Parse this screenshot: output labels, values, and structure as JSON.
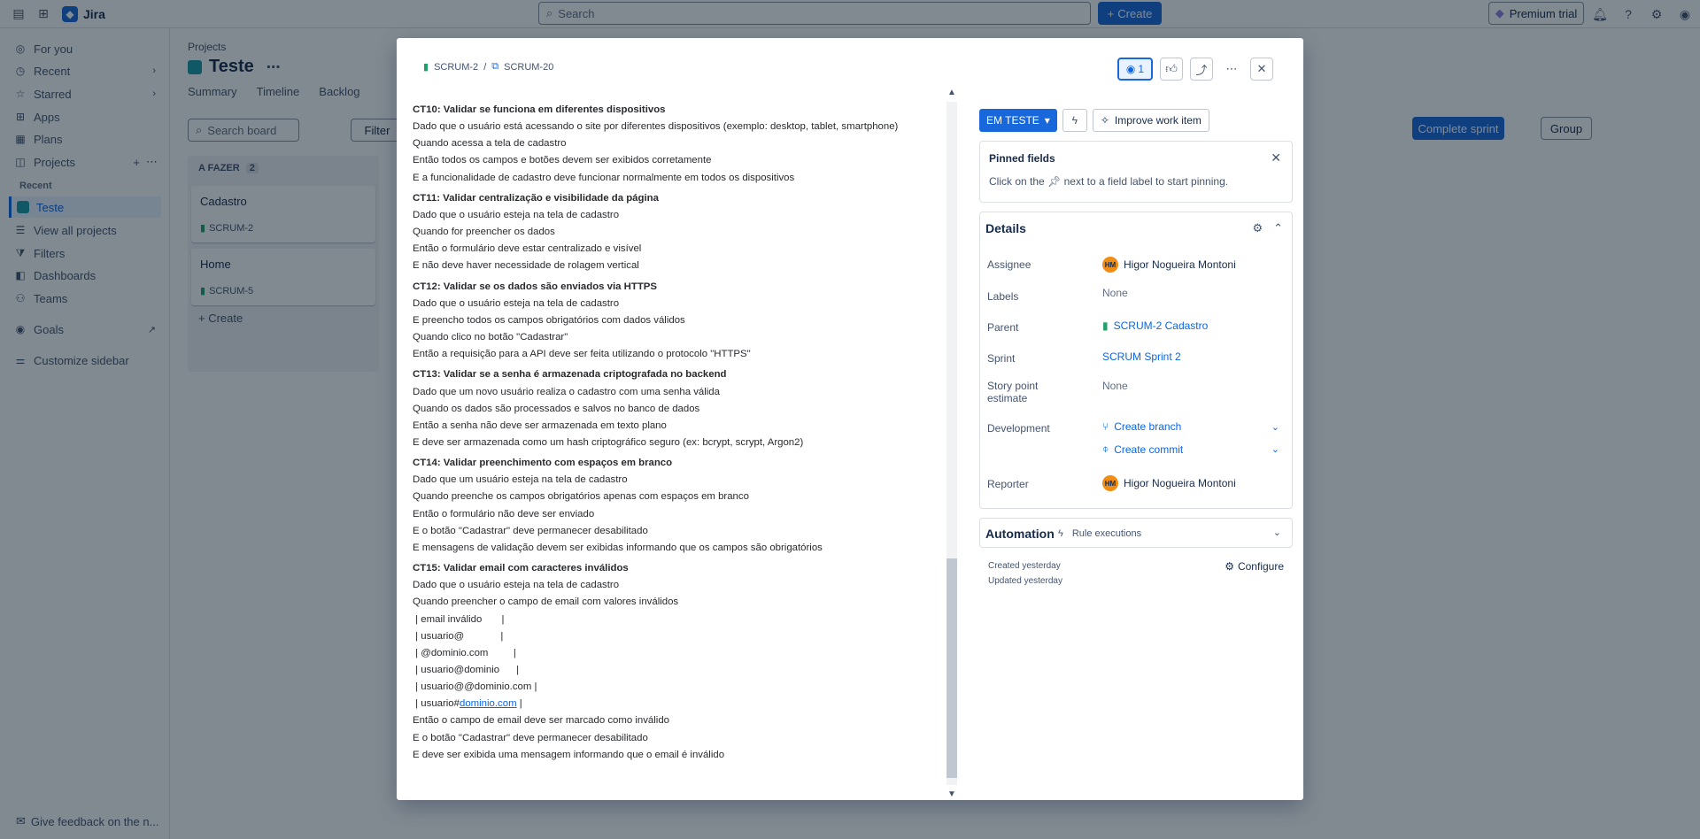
{
  "app": {
    "name": "Jira"
  },
  "topbar": {
    "search_placeholder": "Search",
    "create_label": "Create",
    "premium_label": "Premium trial"
  },
  "sidebar": {
    "items": [
      {
        "label": "For you",
        "icon": "user-circle-icon"
      },
      {
        "label": "Recent",
        "icon": "clock-icon"
      },
      {
        "label": "Starred",
        "icon": "star-icon"
      },
      {
        "label": "Apps",
        "icon": "apps-icon"
      },
      {
        "label": "Plans",
        "icon": "plans-icon"
      },
      {
        "label": "Projects",
        "icon": "projects-icon"
      }
    ],
    "recent_heading": "Recent",
    "project_item": "Teste",
    "view_all": "View all projects",
    "lower_items": [
      {
        "label": "Filters"
      },
      {
        "label": "Dashboards"
      },
      {
        "label": "Teams"
      },
      {
        "label": "Goals"
      },
      {
        "label": "Customize sidebar"
      }
    ],
    "feedback": "Give feedback on the n..."
  },
  "main": {
    "breadcrumb": "Projects",
    "title": "Teste",
    "tabs": [
      "Summary",
      "Timeline",
      "Backlog"
    ],
    "board_search_placeholder": "Search board",
    "filter_label": "Filter",
    "column": {
      "title": "A FAZER",
      "count": "2"
    },
    "cards": [
      {
        "title": "Cadastro",
        "key": "SCRUM-2"
      },
      {
        "title": "Home",
        "key": "SCRUM-5"
      }
    ],
    "col_create": "Create",
    "complete_sprint": "Complete sprint",
    "group": "Group"
  },
  "modal": {
    "breadcrumb": {
      "parent": "SCRUM-2",
      "current": "SCRUM-20"
    },
    "watch_count": "1",
    "description": [
      {
        "type": "h",
        "text": "CT10: Validar se funciona em diferentes dispositivos"
      },
      {
        "type": "p",
        "text": "Dado que o usuário está acessando o site por diferentes dispositivos (exemplo: desktop, tablet, smartphone)"
      },
      {
        "type": "p",
        "text": "Quando acessa a tela de cadastro"
      },
      {
        "type": "p",
        "text": "Então todos os campos e botões devem ser exibidos corretamente"
      },
      {
        "type": "p",
        "text": "E a funcionalidade de cadastro deve funcionar normalmente em todos os dispositivos"
      },
      {
        "type": "h",
        "text": "CT11: Validar centralização e visibilidade da página"
      },
      {
        "type": "p",
        "text": "Dado que o usuário esteja na tela de cadastro"
      },
      {
        "type": "p",
        "text": "Quando for preencher os dados"
      },
      {
        "type": "p",
        "text": "Então o formulário deve estar centralizado e visível"
      },
      {
        "type": "p",
        "text": "E não deve haver necessidade de rolagem vertical"
      },
      {
        "type": "h",
        "text": "CT12: Validar se os dados são enviados via HTTPS"
      },
      {
        "type": "p",
        "text": "Dado que o usuário esteja na tela de cadastro"
      },
      {
        "type": "p",
        "text": "E preencho todos os campos obrigatórios com dados válidos"
      },
      {
        "type": "p",
        "text": "Quando clico no botão \"Cadastrar\""
      },
      {
        "type": "p",
        "text": "Então a requisição para a API deve ser feita utilizando o protocolo \"HTTPS\""
      },
      {
        "type": "h",
        "text": "CT13: Validar se a senha é armazenada criptografada no backend"
      },
      {
        "type": "p",
        "text": "Dado que um novo usuário realiza o cadastro com uma senha válida"
      },
      {
        "type": "p",
        "text": "Quando os dados são processados e salvos no banco de dados"
      },
      {
        "type": "p",
        "text": "Então a senha não deve ser armazenada em texto plano"
      },
      {
        "type": "p",
        "text": "E deve ser armazenada como um hash criptográfico seguro (ex: bcrypt, scrypt, Argon2)"
      },
      {
        "type": "h",
        "text": "CT14: Validar preenchimento com espaços em branco"
      },
      {
        "type": "p",
        "text": "Dado que um usuário esteja na tela de cadastro"
      },
      {
        "type": "p",
        "text": "Quando preenche os campos obrigatórios apenas com espaços em branco"
      },
      {
        "type": "p",
        "text": "Então o formulário não deve ser enviado"
      },
      {
        "type": "p",
        "text": "E o botão \"Cadastrar\" deve permanecer desabilitado"
      },
      {
        "type": "p",
        "text": "E mensagens de validação devem ser exibidas informando que os campos são obrigatórios"
      },
      {
        "type": "h",
        "text": "CT15: Validar email com caracteres inválidos"
      },
      {
        "type": "p",
        "text": "Dado que o usuário esteja na tela de cadastro"
      },
      {
        "type": "p",
        "text": "Quando preencher o campo de email com valores inválidos"
      },
      {
        "type": "p",
        "text": " | email inválido       |"
      },
      {
        "type": "p",
        "text": " | usuario@             |"
      },
      {
        "type": "p",
        "text": " | @dominio.com         |"
      },
      {
        "type": "p",
        "text": " | usuario@dominio      |"
      },
      {
        "type": "p",
        "text": " | usuario@@dominio.com |"
      },
      {
        "type": "link",
        "prefix": " | usuario#",
        "link": "dominio.com",
        "suffix": " |"
      },
      {
        "type": "p",
        "text": "Então o campo de email deve ser marcado como inválido"
      },
      {
        "type": "p",
        "text": "E o botão \"Cadastrar\" deve permanecer desabilitado"
      },
      {
        "type": "p",
        "text": "E deve ser exibida uma mensagem informando que o email é inválido"
      }
    ],
    "status": "EM TESTE",
    "improve_label": "Improve work item",
    "pinned": {
      "title": "Pinned fields",
      "text_before": "Click on the",
      "text_after": "next to a field label to start pinning."
    },
    "details": {
      "title": "Details",
      "assignee_label": "Assignee",
      "assignee_initials": "HM",
      "assignee_name": "Higor Nogueira Montoni",
      "labels_label": "Labels",
      "labels_value": "None",
      "parent_label": "Parent",
      "parent_value": "SCRUM-2 Cadastro",
      "sprint_label": "Sprint",
      "sprint_value": "SCRUM Sprint 2",
      "story_label": "Story point estimate",
      "story_value": "None",
      "development_label": "Development",
      "create_branch": "Create branch",
      "create_commit": "Create commit",
      "reporter_label": "Reporter",
      "reporter_initials": "HM",
      "reporter_name": "Higor Nogueira Montoni"
    },
    "automation": {
      "title": "Automation",
      "sub": "Rule executions"
    },
    "created": "Created yesterday",
    "updated": "Updated yesterday",
    "configure": "Configure"
  }
}
